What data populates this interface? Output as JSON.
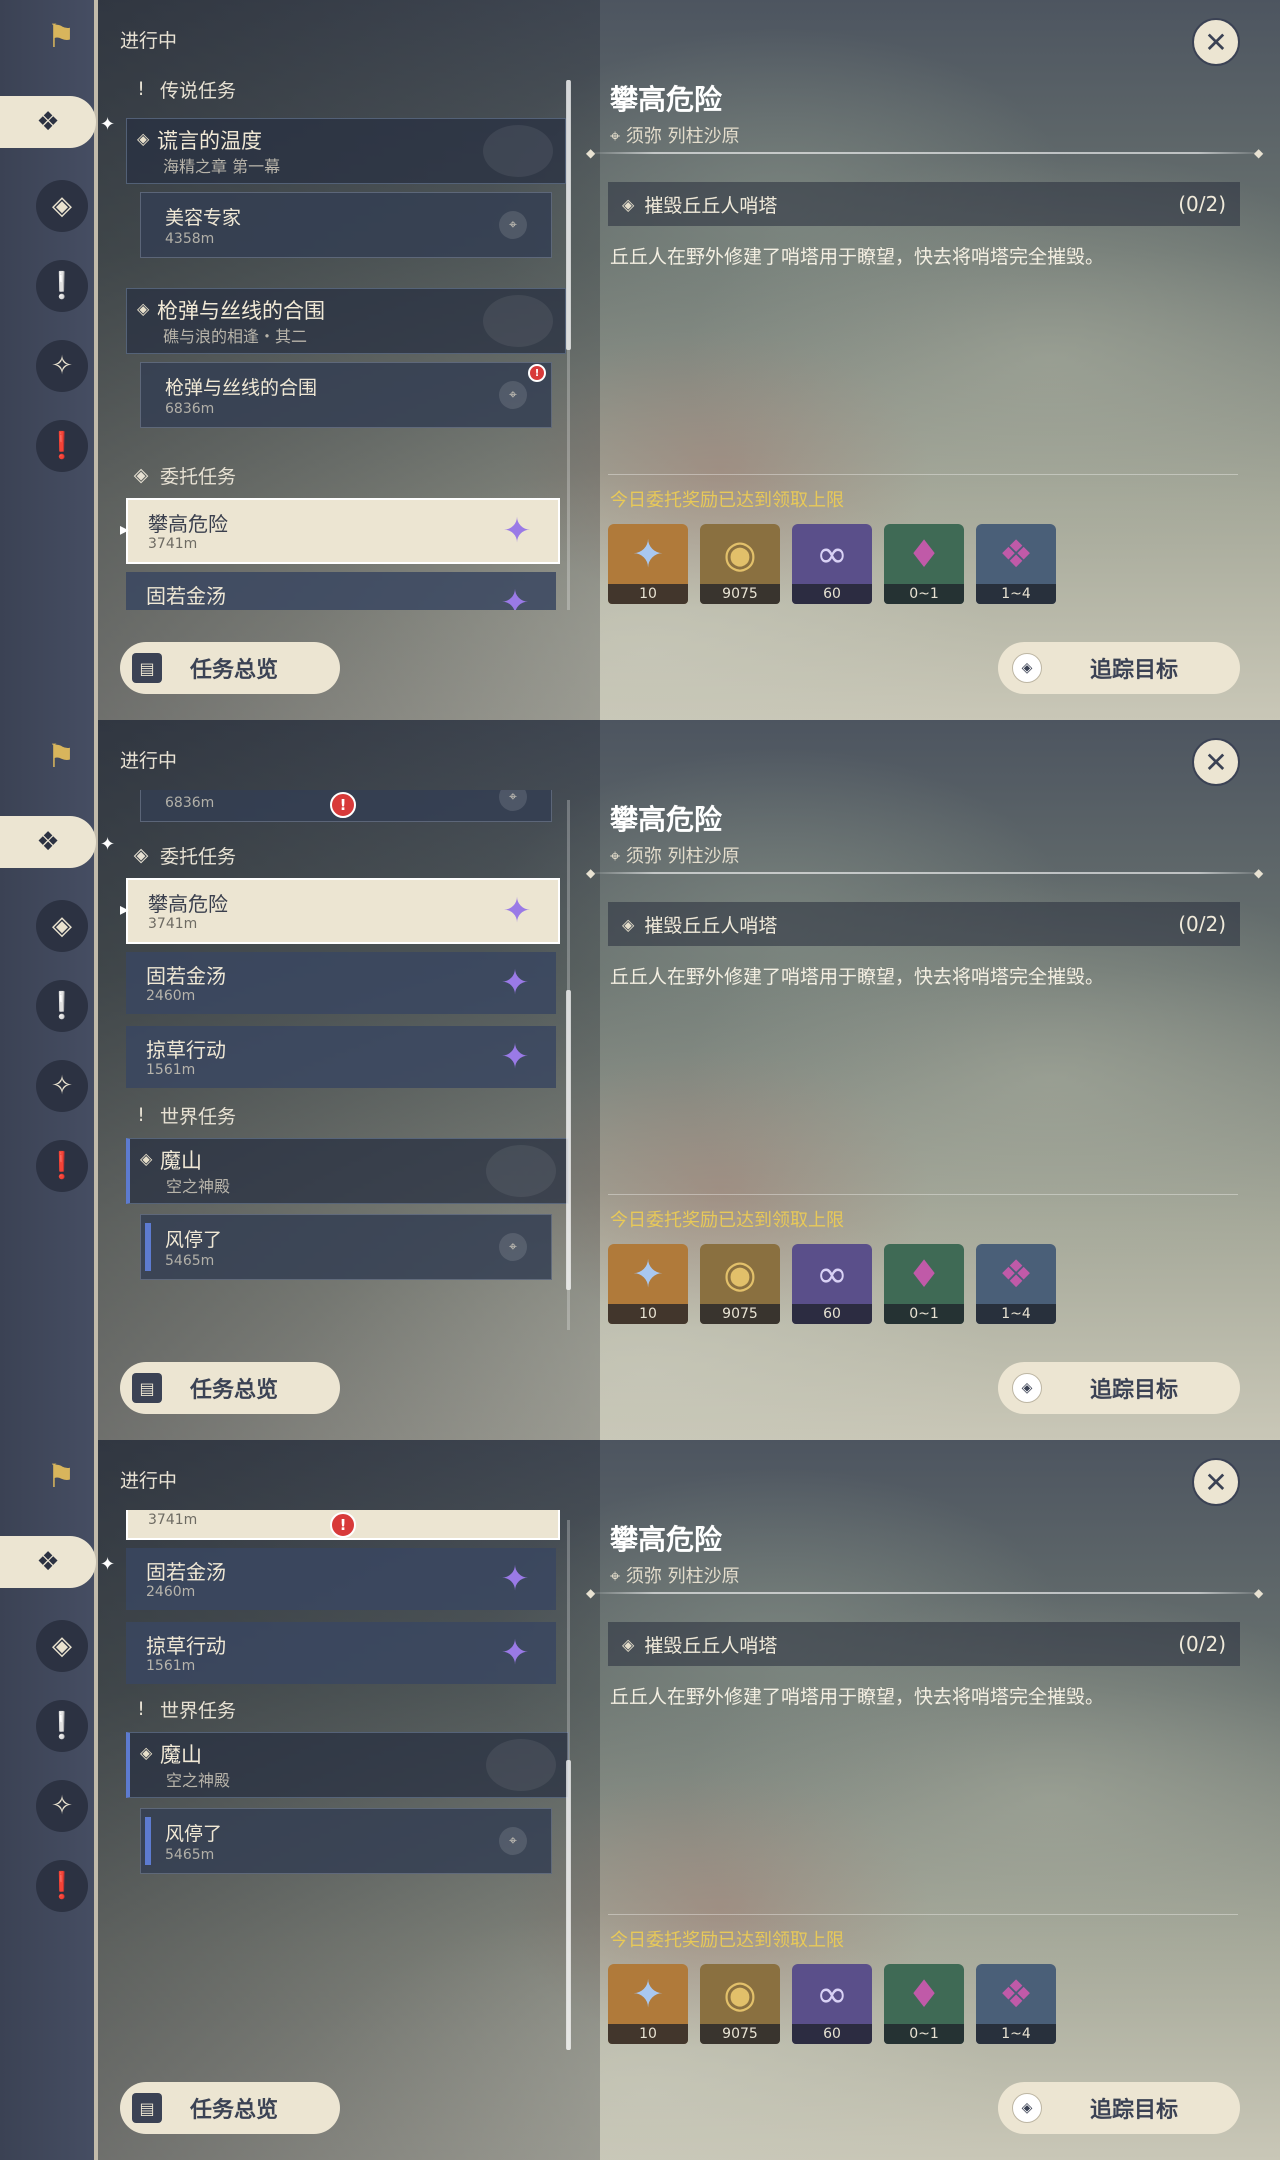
{
  "status_title": "进行中",
  "close_icon": "✕",
  "categories": {
    "archon": "传说任务",
    "commission": "委托任务",
    "world": "世界任务"
  },
  "quests": {
    "q1_title": "谎言的温度",
    "q1_sub": "海精之章 第一幕",
    "q1_step": "美容专家",
    "q1_step_dist": "4358m",
    "q2_title": "枪弹与丝线的合围",
    "q2_sub": "礁与浪的相逢・其二",
    "q2_step": "枪弹与丝线的合围",
    "q2_step_dist": "6836m",
    "world_title": "魔山",
    "world_sub": "空之神殿",
    "world_step": "风停了",
    "world_step_dist": "5465m"
  },
  "commissions": [
    {
      "label": "攀高危险",
      "dist": "3741m"
    },
    {
      "label": "固若金汤",
      "dist": "2460m"
    },
    {
      "label": "掠草行动",
      "dist": "1561m"
    }
  ],
  "overview_button": "任务总览",
  "track_button": "追踪目标",
  "detail": {
    "title": "攀高危险",
    "location": "须弥 列柱沙原",
    "objective": "摧毁丘丘人哨塔",
    "progress": "(0/2)",
    "description": "丘丘人在野外修建了哨塔用于瞭望，快去将哨塔完全摧毁。",
    "reward_note": "今日委托奖励已达到领取上限"
  },
  "rewards": [
    {
      "icon": "primogem-icon",
      "qty": "10",
      "color": "#b07a3a"
    },
    {
      "icon": "mora-icon",
      "qty": "9075",
      "color": "#8a7040"
    },
    {
      "icon": "companionship-exp-icon",
      "qty": "60",
      "color": "#5a4f8a"
    },
    {
      "icon": "ore-crystal-icon",
      "qty": "0~1",
      "color": "#3f6a55"
    },
    {
      "icon": "ore-crystal-cluster-icon",
      "qty": "1~4",
      "color": "#4a5f78"
    }
  ]
}
